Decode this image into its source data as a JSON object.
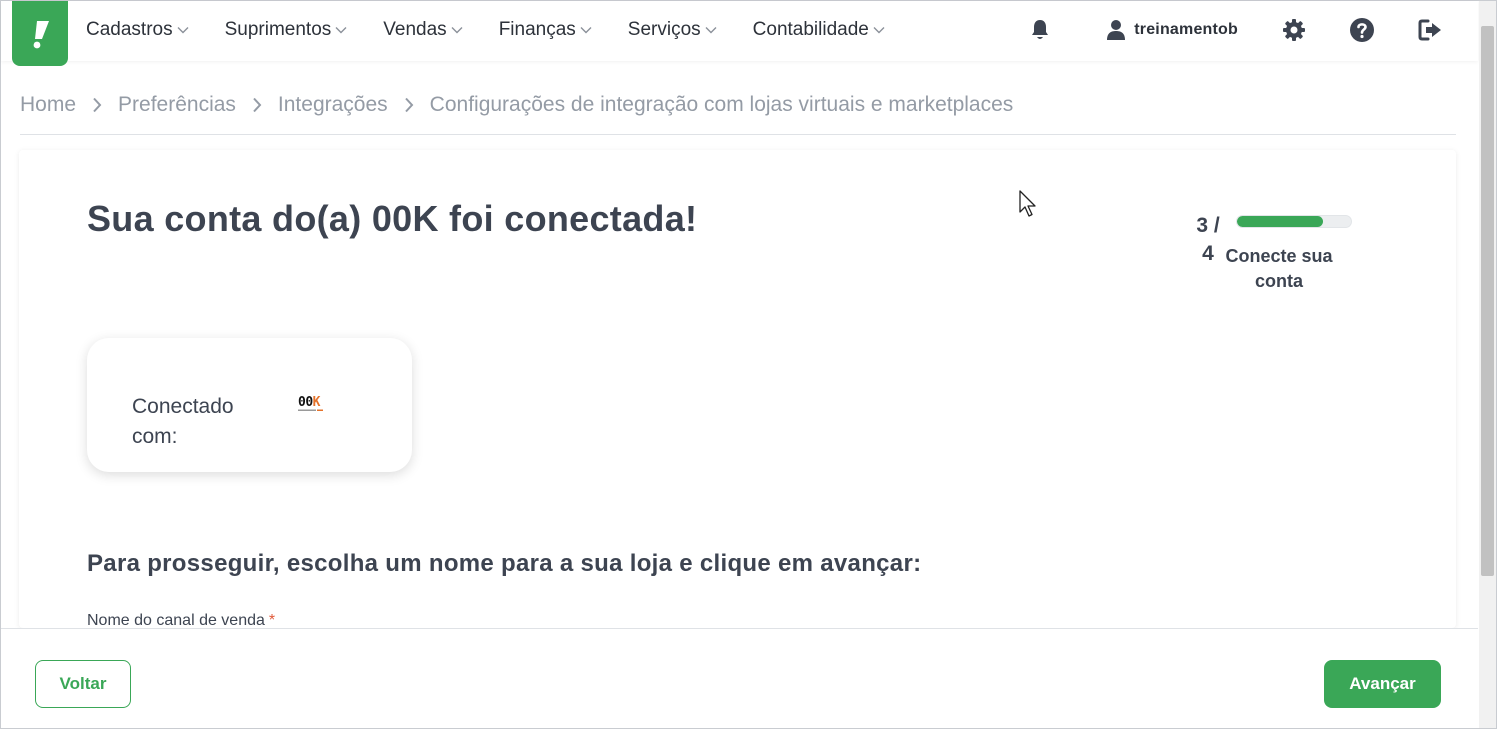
{
  "nav": {
    "menu": [
      {
        "label": "Cadastros"
      },
      {
        "label": "Suprimentos"
      },
      {
        "label": "Vendas"
      },
      {
        "label": "Finanças"
      },
      {
        "label": "Serviços"
      },
      {
        "label": "Contabilidade"
      }
    ],
    "user_name": "treinamentob",
    "icons": [
      "bell-icon",
      "user-icon",
      "gear-icon",
      "help-icon",
      "logout-icon"
    ]
  },
  "breadcrumb": [
    {
      "label": "Home"
    },
    {
      "label": "Preferências"
    },
    {
      "label": "Integrações"
    },
    {
      "label": "Configurações de integração com lojas virtuais e marketplaces"
    }
  ],
  "main": {
    "title": "Sua conta do(a) 00K foi conectada!",
    "step": {
      "current": "3 /",
      "total": "4",
      "label": "Conecte sua conta",
      "progress_fraction": 0.75
    },
    "connected": {
      "label": "Conectado com:",
      "logo_text_a": "00",
      "logo_text_b": "K"
    },
    "subtitle": "Para prosseguir, escolha um nome para a sua loja e clique em avançar:",
    "field_label": "Nome do canal de venda",
    "required_mark": "*"
  },
  "footer": {
    "back_label": "Voltar",
    "next_label": "Avançar"
  },
  "colors": {
    "brand": "#3aa757",
    "text": "#3d4451",
    "muted": "#949ba5"
  }
}
